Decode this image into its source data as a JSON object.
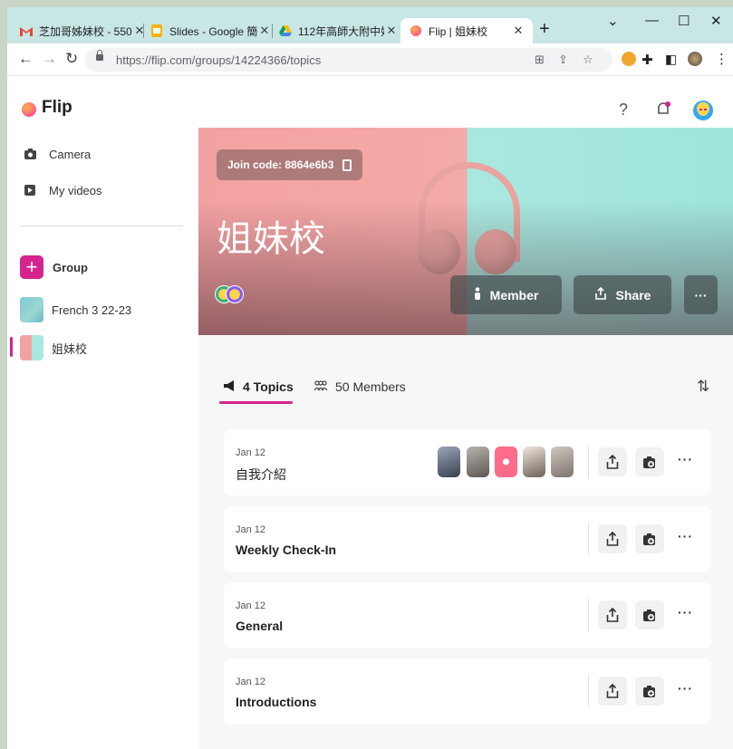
{
  "browser": {
    "tabs": [
      {
        "title": "芝加哥姊妹校 - 550",
        "icon": "gmail-icon"
      },
      {
        "title": "Slides - Google 簡",
        "icon": "google-slides-icon"
      },
      {
        "title": "112年高師大附中姊",
        "icon": "google-drive-icon"
      },
      {
        "title": "Flip | 姐妹校",
        "icon": "flip-icon",
        "active": true
      }
    ],
    "url": "https://flip.com/groups/14224366/topics"
  },
  "app": {
    "brand": "Flip",
    "help_label": "?"
  },
  "sidebar": {
    "items": [
      {
        "label": "Camera",
        "icon": "camera-icon"
      },
      {
        "label": "My videos",
        "icon": "video-icon"
      }
    ],
    "group_label": "Group",
    "groups": [
      {
        "label": "French 3 22-23"
      },
      {
        "label": "姐妹校",
        "active": true
      }
    ]
  },
  "hero": {
    "join_code": "Join code: 8864e6b3",
    "title": "姐妹校",
    "member_label": "Member",
    "share_label": "Share",
    "more_label": "···"
  },
  "tabs": {
    "topics": "4 Topics",
    "members": "50 Members"
  },
  "topics": [
    {
      "date": "Jan 12",
      "name": "自我介紹",
      "has_thumbs": true
    },
    {
      "date": "Jan 12",
      "name": "Weekly Check-In"
    },
    {
      "date": "Jan 12",
      "name": "General"
    },
    {
      "date": "Jan 12",
      "name": "Introductions"
    }
  ],
  "colors": {
    "accent": "#d6248f",
    "hero_left": "#f3a2a2",
    "hero_right": "#a9e8df"
  }
}
